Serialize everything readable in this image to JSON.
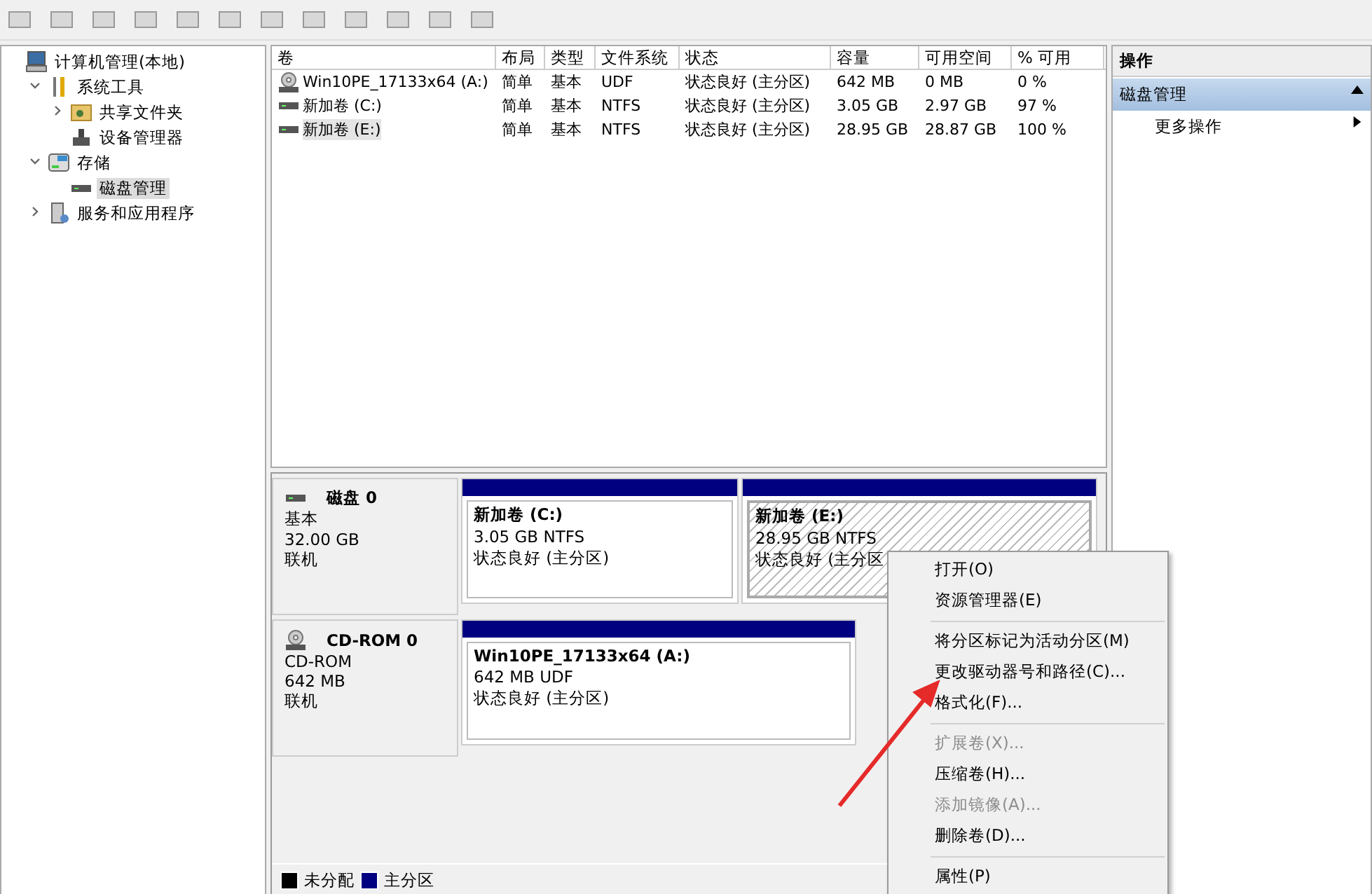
{
  "tree": [
    {
      "label": "计算机管理(本地)",
      "kind": "computer",
      "selected": false,
      "children": [
        {
          "label": "系统工具",
          "kind": "tools",
          "expanded": true,
          "selected": false,
          "children": [
            {
              "label": "共享文件夹",
              "kind": "share",
              "expanded": false,
              "selected": false
            },
            {
              "label": "设备管理器",
              "kind": "device",
              "selected": false
            }
          ]
        },
        {
          "label": "存储",
          "kind": "storage",
          "expanded": true,
          "selected": false,
          "children": [
            {
              "label": "磁盘管理",
              "kind": "disk",
              "selected": true
            }
          ]
        },
        {
          "label": "服务和应用程序",
          "kind": "services",
          "expanded": false,
          "selected": false
        }
      ]
    }
  ],
  "volume_table": {
    "columns": [
      "卷",
      "布局",
      "类型",
      "文件系统",
      "状态",
      "容量",
      "可用空间",
      "% 可用"
    ],
    "rows": [
      {
        "kind": "cdrom",
        "selected": false,
        "cells": [
          "Win10PE_17133x64 (A:)",
          "简单",
          "基本",
          "UDF",
          "状态良好 (主分区)",
          "642 MB",
          "0 MB",
          "0 %"
        ]
      },
      {
        "kind": "disk",
        "selected": false,
        "cells": [
          "新加卷 (C:)",
          "简单",
          "基本",
          "NTFS",
          "状态良好 (主分区)",
          "3.05 GB",
          "2.97 GB",
          "97 %"
        ]
      },
      {
        "kind": "disk",
        "selected": true,
        "cells": [
          "新加卷 (E:)",
          "简单",
          "基本",
          "NTFS",
          "状态良好 (主分区)",
          "28.95 GB",
          "28.87 GB",
          "100 %"
        ]
      }
    ]
  },
  "disks": [
    {
      "kind": "disk",
      "name": "磁盘 0",
      "type": "基本",
      "size": "32.00 GB",
      "status": "联机",
      "partitions": [
        {
          "title": "新加卷  (C:)",
          "size_fs": "3.05 GB NTFS",
          "status": "状态良好 (主分区)",
          "selected": false
        },
        {
          "title": "新加卷  (E:)",
          "size_fs": "28.95 GB NTFS",
          "status": "状态良好 (主分区",
          "selected": true
        }
      ]
    },
    {
      "kind": "cdrom",
      "name": "CD-ROM 0",
      "type": "CD-ROM",
      "size": "642 MB",
      "status": "联机",
      "partitions": [
        {
          "title": "Win10PE_17133x64  (A:)",
          "size_fs": "642 MB UDF",
          "status": "状态良好 (主分区)",
          "selected": false
        }
      ]
    }
  ],
  "legend": [
    {
      "label": "未分配",
      "color": "#000000"
    },
    {
      "label": "主分区",
      "color": "#000080"
    }
  ],
  "actions": {
    "title": "操作",
    "section": "磁盘管理",
    "items": [
      "更多操作"
    ]
  },
  "context_menu": [
    {
      "kind": "item",
      "label": "打开(O)",
      "disabled": false
    },
    {
      "kind": "item",
      "label": "资源管理器(E)",
      "disabled": false
    },
    {
      "kind": "separator"
    },
    {
      "kind": "item",
      "label": "将分区标记为活动分区(M)",
      "disabled": false
    },
    {
      "kind": "item",
      "label": "更改驱动器号和路径(C)...",
      "disabled": false
    },
    {
      "kind": "item",
      "label": "格式化(F)...",
      "disabled": false
    },
    {
      "kind": "separator"
    },
    {
      "kind": "item",
      "label": "扩展卷(X)...",
      "disabled": true
    },
    {
      "kind": "item",
      "label": "压缩卷(H)...",
      "disabled": false
    },
    {
      "kind": "item",
      "label": "添加镜像(A)...",
      "disabled": true
    },
    {
      "kind": "item",
      "label": "删除卷(D)...",
      "disabled": false
    },
    {
      "kind": "separator"
    },
    {
      "kind": "item",
      "label": "属性(P)",
      "disabled": false
    }
  ]
}
